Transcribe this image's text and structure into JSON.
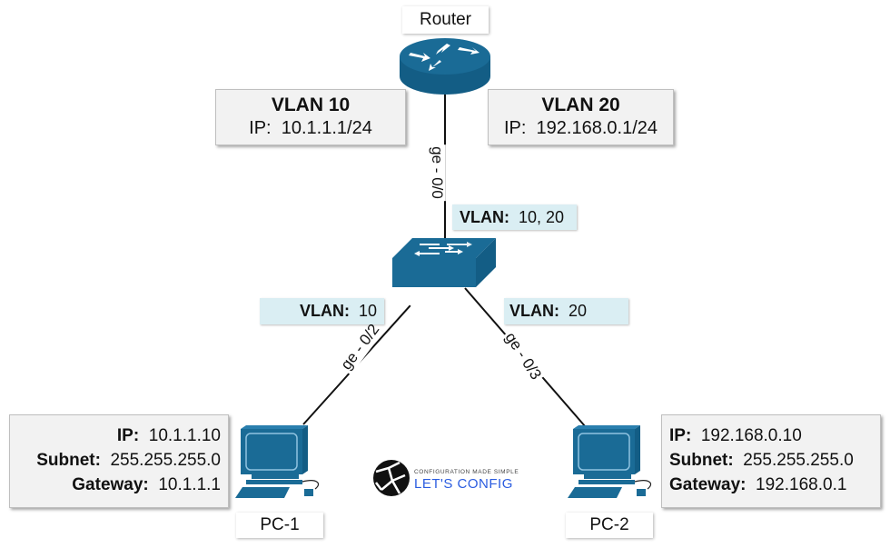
{
  "devices": {
    "router": {
      "label": "Router",
      "icon": "router-icon"
    },
    "switch": {
      "icon": "switch-icon"
    },
    "pc1": {
      "label": "PC-1",
      "icon": "desktop-computer-icon"
    },
    "pc2": {
      "label": "PC-2",
      "icon": "desktop-computer-icon"
    }
  },
  "router_interfaces": {
    "vlan10": {
      "title": "VLAN 10",
      "ip_label": "IP:",
      "ip": "10.1.1.1/24"
    },
    "vlan20": {
      "title": "VLAN 20",
      "ip_label": "IP:",
      "ip": "192.168.0.1/24"
    }
  },
  "links": {
    "router_switch": {
      "port": "ge - 0/0",
      "vlan_label": "VLAN:",
      "vlan": "10, 20"
    },
    "switch_pc1": {
      "port": "ge - 0/2",
      "vlan_label": "VLAN:",
      "vlan": "10"
    },
    "switch_pc2": {
      "port": "ge - 0/3",
      "vlan_label": "VLAN:",
      "vlan": "20"
    }
  },
  "pc1_config": {
    "ip_label": "IP:",
    "ip": "10.1.1.10",
    "subnet_label": "Subnet:",
    "subnet": "255.255.255.0",
    "gateway_label": "Gateway:",
    "gateway": "10.1.1.1"
  },
  "pc2_config": {
    "ip_label": "IP:",
    "ip": "192.168.0.10",
    "subnet_label": "Subnet:",
    "subnet": "255.255.255.0",
    "gateway_label": "Gateway:",
    "gateway": "192.168.0.1"
  },
  "logo": {
    "tagline": "CONFIGURATION MADE SIMPLE",
    "name": "LET'S CONFIG"
  },
  "colors": {
    "device_blue": "#1a6b96",
    "vlan_box": "#daeef3",
    "info_box": "#f2f2f2",
    "logo_blue": "#2a5ce0"
  }
}
